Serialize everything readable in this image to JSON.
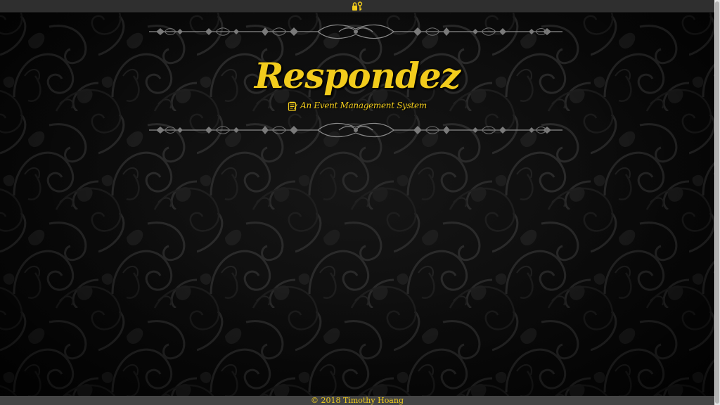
{
  "header": {
    "icon": "lock-key-icon",
    "accent_color": "#f2cc1c"
  },
  "hero": {
    "title": "Respondez",
    "tagline": "An Event Management System",
    "tagline_icon": "notepad-icon"
  },
  "footer": {
    "copyright": "© 2018 Timothy Hoang"
  },
  "theme": {
    "background": "#0c0c0c",
    "topbar": "#2f2f2f",
    "footer": "#444444",
    "text_accent": "#f2cc1c",
    "ornament": "#8a8a8a"
  }
}
